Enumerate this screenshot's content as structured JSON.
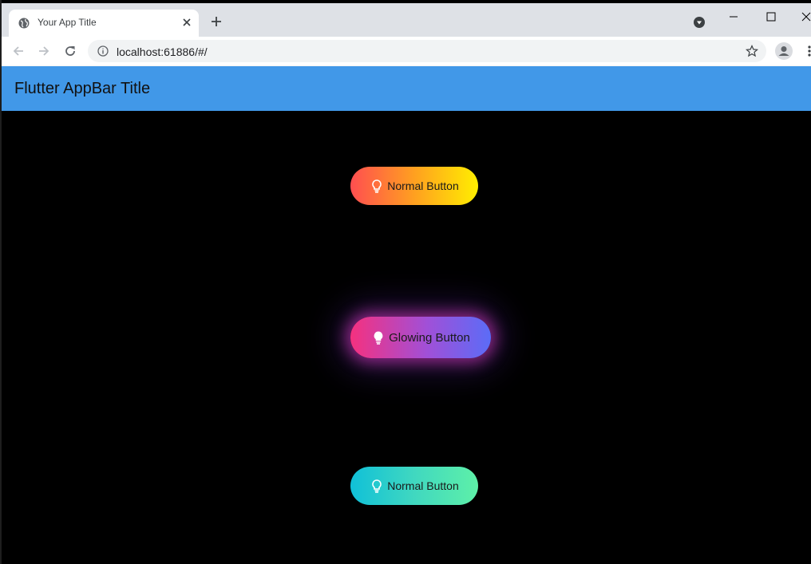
{
  "browser": {
    "tab_title": "Your App Title",
    "url": "localhost:61886/#/"
  },
  "appbar": {
    "title": "Flutter AppBar Title"
  },
  "buttons": [
    {
      "label": "Normal Button",
      "gradient": [
        "#ff4e50",
        "#ffee00"
      ],
      "icon": "lightbulb-outline-icon"
    },
    {
      "label": "Glowing Button",
      "gradient": [
        "#f5317f",
        "#5b6cf7"
      ],
      "icon": "lightbulb-icon",
      "glow": true
    },
    {
      "label": "Normal Button",
      "gradient": [
        "#10c0d8",
        "#5ef0a8"
      ],
      "icon": "lightbulb-outline-icon"
    }
  ],
  "colors": {
    "appbar": "#4198e8",
    "background": "#000000"
  }
}
